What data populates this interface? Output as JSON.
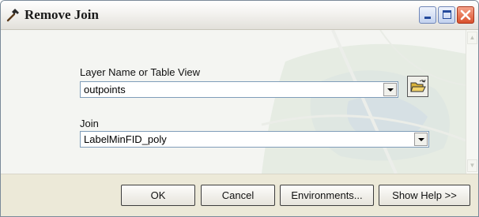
{
  "window": {
    "title": "Remove Join"
  },
  "icons": {
    "title": "hammer-icon",
    "browse": "open-folder-icon",
    "minimize": "minimize-icon",
    "maximize": "maximize-icon",
    "close": "close-icon"
  },
  "form": {
    "layer_label": "Layer Name or Table View",
    "layer_value": "outpoints",
    "join_label": "Join",
    "join_value": "LabelMinFID_poly"
  },
  "buttons": {
    "ok": "OK",
    "cancel": "Cancel",
    "environments": "Environments...",
    "show_help": "Show Help >>"
  },
  "colors": {
    "title_bar": "#e9e8e3",
    "close_button": "#d9512c",
    "window_button": "#c3d2ef",
    "field_border": "#7f9db9",
    "dialog_face": "#ece9d8"
  }
}
